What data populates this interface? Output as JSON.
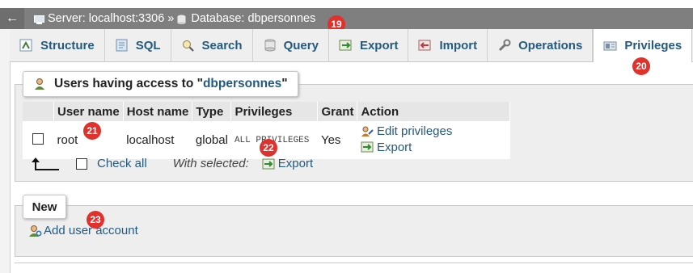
{
  "breadcrumb": {
    "back": "←",
    "server": "Server: localhost:3306",
    "separator": "»",
    "database": "Database: dbpersonnes"
  },
  "tabs": [
    {
      "label": "Structure",
      "icon": "structure-icon"
    },
    {
      "label": "SQL",
      "icon": "sql-icon"
    },
    {
      "label": "Search",
      "icon": "search-icon"
    },
    {
      "label": "Query",
      "icon": "query-icon"
    },
    {
      "label": "Export",
      "icon": "export-icon"
    },
    {
      "label": "Import",
      "icon": "import-icon"
    },
    {
      "label": "Operations",
      "icon": "wrench-icon"
    },
    {
      "label": "Privileges",
      "icon": "privileges-icon",
      "active": true
    }
  ],
  "users_panel": {
    "legend_prefix": "Users having access to \"",
    "legend_db": "dbpersonnes",
    "legend_suffix": "\"",
    "columns": [
      "",
      "User name",
      "Host name",
      "Type",
      "Privileges",
      "Grant",
      "Action"
    ],
    "rows": [
      {
        "user": "root",
        "host": "localhost",
        "type": "global",
        "privileges": "ALL PRIVILEGES",
        "grant": "Yes",
        "edit_label": "Edit privileges",
        "export_label": "Export"
      }
    ],
    "check_all": "Check all",
    "with_selected": "With selected:",
    "export_selected": "Export"
  },
  "new_panel": {
    "legend": "New",
    "add_user": "Add user account"
  },
  "badges": [
    "19",
    "20",
    "21",
    "22",
    "23"
  ],
  "colors": {
    "accent": "#235a81",
    "badge": "#e0312c",
    "breadcrumb_bg": "#7f7f7f"
  }
}
